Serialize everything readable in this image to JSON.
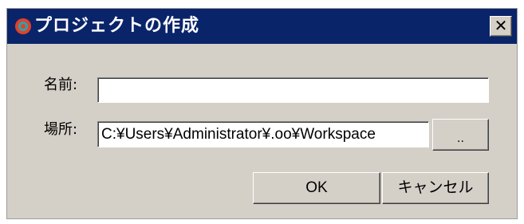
{
  "window": {
    "title": "プロジェクトの作成",
    "close_glyph": "✕"
  },
  "form": {
    "name_label": "名前:",
    "name_value": "",
    "location_label": "場所:",
    "location_value": "C:¥Users¥Administrator¥.oo¥Workspace",
    "browse_label": ".."
  },
  "buttons": {
    "ok_label": "OK",
    "cancel_label": "キャンセル"
  },
  "icons": {
    "app": "app-logo-icon",
    "close": "close-icon"
  },
  "colors": {
    "title_bar": "#0a246a",
    "dialog_face": "#d4d0c8",
    "icon_red": "#e0422a",
    "icon_teal": "#2aa3b0"
  }
}
